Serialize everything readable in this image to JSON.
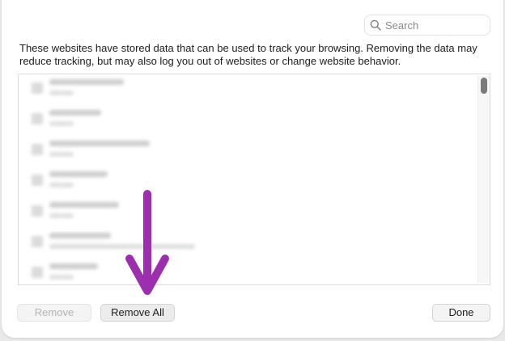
{
  "search": {
    "placeholder": "Search",
    "icon": "magnifying-glass-icon"
  },
  "description": "These websites have stored data that can be used to track your browsing. Removing the data may reduce tracking, but may also log you out of websites or change website behavior.",
  "buttons": {
    "remove": "Remove",
    "remove_all": "Remove All",
    "done": "Done"
  },
  "colors": {
    "annotation_arrow": "#9b2fae"
  }
}
